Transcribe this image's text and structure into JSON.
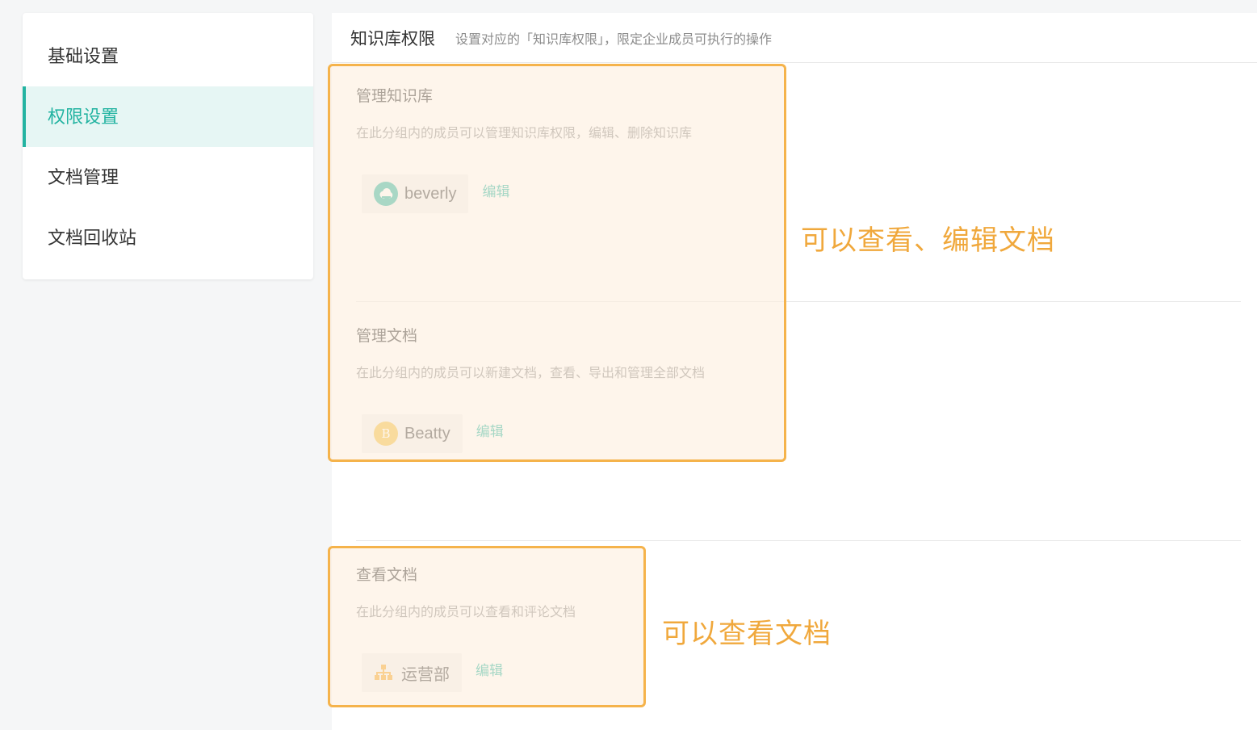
{
  "sidebar": {
    "items": [
      {
        "label": "基础设置",
        "active": false
      },
      {
        "label": "权限设置",
        "active": true
      },
      {
        "label": "文档管理",
        "active": false
      },
      {
        "label": "文档回收站",
        "active": false
      }
    ]
  },
  "header": {
    "title": "知识库权限",
    "description": "设置对应的「知识库权限」，限定企业成员可执行的操作"
  },
  "sections": [
    {
      "title": "管理知识库",
      "description": "在此分组内的成员可以管理知识库权限，编辑、删除知识库",
      "member": {
        "name": "beverly",
        "avatar": "cloud-avatar-icon"
      },
      "edit_label": "编辑"
    },
    {
      "title": "管理文档",
      "description": "在此分组内的成员可以新建文档，查看、导出和管理全部文档",
      "member": {
        "name": "Beatty",
        "avatar_letter": "B"
      },
      "edit_label": "编辑"
    },
    {
      "title": "查看文档",
      "description": "在此分组内的成员可以查看和评论文档",
      "member": {
        "name": "运营部",
        "avatar": "org-chart-icon"
      },
      "edit_label": "编辑"
    }
  ],
  "annotations": {
    "top": "可以查看、编辑文档",
    "bottom": "可以查看文档"
  },
  "colors": {
    "accent": "#22b3a1",
    "highlight_border": "#f5b34b",
    "annotation_text": "#f0a83c",
    "org_icon": "#f5a623"
  }
}
